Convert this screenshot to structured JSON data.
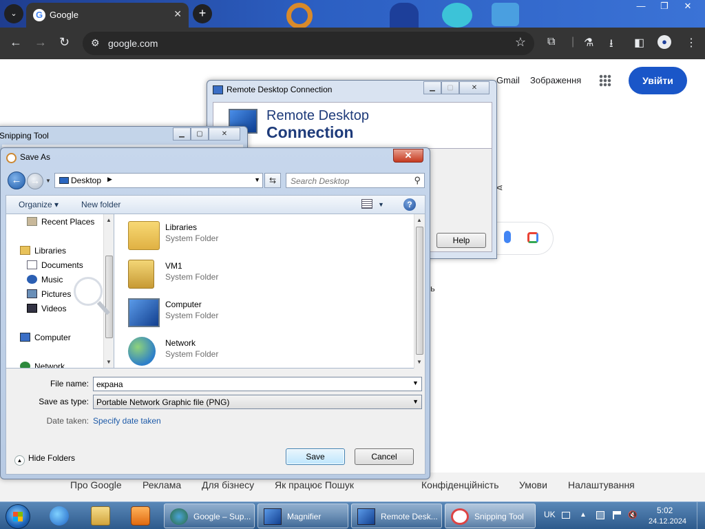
{
  "browser": {
    "tab_title": "Google",
    "url": "google.com",
    "tab_close": "✕",
    "new_tab": "+"
  },
  "google": {
    "links": {
      "gmail": "Gmail",
      "images": "Зображення"
    },
    "sign_in": "Увійти",
    "fragment_text": "ь",
    "footer": {
      "about": "Про Google",
      "ads": "Реклама",
      "business": "Для бізнесу",
      "how_search_works": "Як працює Пошук",
      "privacy": "Конфіденційність",
      "terms": "Умови",
      "settings": "Налаштування"
    }
  },
  "rdp": {
    "title": "Remote Desktop Connection",
    "banner_line1": "Remote Desktop",
    "banner_line2": "Connection",
    "help_button": "Help"
  },
  "snipping": {
    "title": "Snipping Tool"
  },
  "save_as": {
    "title": "Save As",
    "address": "Desktop",
    "search_placeholder": "Search Desktop",
    "commands": {
      "organize": "Organize ▾",
      "new_folder": "New folder"
    },
    "nav_items": [
      {
        "label": "Recent Places"
      },
      {
        "label": "Libraries"
      },
      {
        "label": "Documents"
      },
      {
        "label": "Music"
      },
      {
        "label": "Pictures"
      },
      {
        "label": "Videos"
      },
      {
        "label": "Computer"
      },
      {
        "label": "Network"
      }
    ],
    "files": [
      {
        "name": "Libraries",
        "type": "System Folder"
      },
      {
        "name": "VM1",
        "type": "System Folder"
      },
      {
        "name": "Computer",
        "type": "System Folder"
      },
      {
        "name": "Network",
        "type": "System Folder"
      }
    ],
    "file_name_label": "File name:",
    "file_name_value": "екрана",
    "save_type_label": "Save as type:",
    "save_type_value": "Portable Network Graphic file (PNG)",
    "date_label": "Date taken:",
    "date_link": "Specify date taken",
    "hide_folders": "Hide Folders",
    "save_button": "Save",
    "cancel_button": "Cancel"
  },
  "taskbar": {
    "buttons": [
      {
        "label": "Google – Sup..."
      },
      {
        "label": "Magnifier"
      },
      {
        "label": "Remote Desk..."
      },
      {
        "label": "Snipping Tool"
      }
    ],
    "language": "UK",
    "time": "5:02",
    "date": "24.12.2024"
  },
  "colors": {
    "chrome_dark": "#353535",
    "google_blue": "#1a56c8",
    "win7_frame": "#c3d4e9",
    "link_blue": "#1d5aa8"
  }
}
